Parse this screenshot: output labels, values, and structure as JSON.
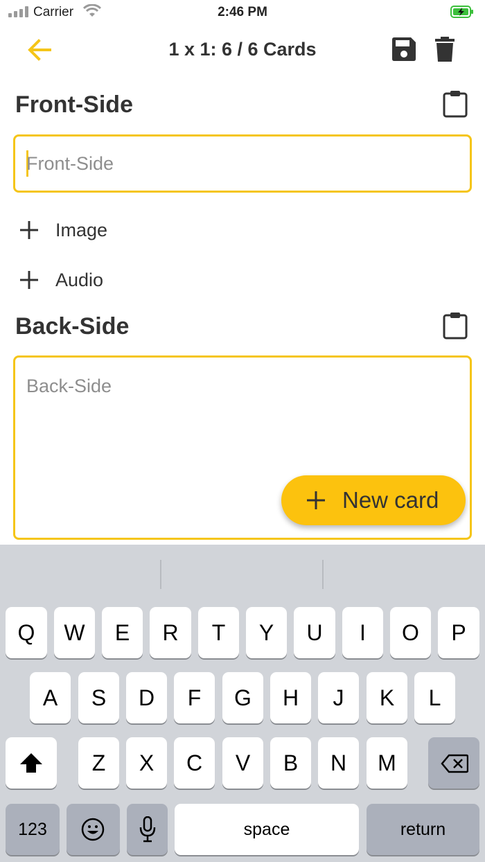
{
  "status_bar": {
    "carrier": "Carrier",
    "time": "2:46 PM"
  },
  "header": {
    "title": "1 x 1: 6 / 6 Cards"
  },
  "front": {
    "heading": "Front-Side",
    "placeholder": "Front-Side"
  },
  "add_image": "Image",
  "add_audio": "Audio",
  "back": {
    "heading": "Back-Side",
    "placeholder": "Back-Side"
  },
  "fab": {
    "label": "New card"
  },
  "keyboard": {
    "row1": [
      "Q",
      "W",
      "E",
      "R",
      "T",
      "Y",
      "U",
      "I",
      "O",
      "P"
    ],
    "row2": [
      "A",
      "S",
      "D",
      "F",
      "G",
      "H",
      "J",
      "K",
      "L"
    ],
    "row3": [
      "Z",
      "X",
      "C",
      "V",
      "B",
      "N",
      "M"
    ],
    "numbers": "123",
    "space": "space",
    "return": "return"
  },
  "colors": {
    "accent": "#f5c518",
    "fab": "#fcc20e",
    "keyboard_bg": "#d1d4d9"
  },
  "icons": [
    "back-arrow-icon",
    "save-icon",
    "trash-icon",
    "clipboard-icon",
    "plus-icon",
    "shift-icon",
    "backspace-icon",
    "emoji-icon",
    "microphone-icon",
    "wifi-icon",
    "battery-icon",
    "signal-icon"
  ]
}
